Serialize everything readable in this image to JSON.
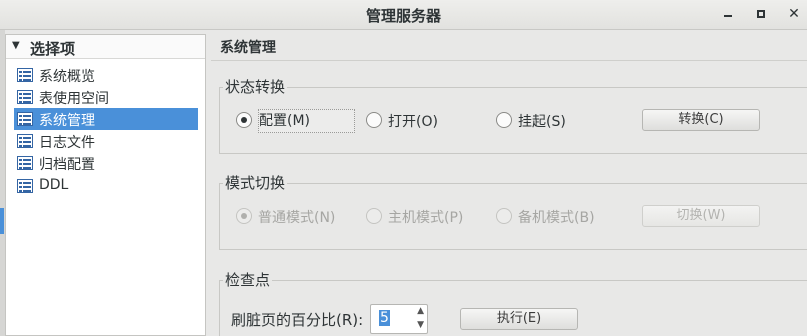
{
  "window": {
    "title": "管理服务器",
    "minimize_icon": "minimize-icon",
    "maximize_icon": "maximize-icon",
    "close_icon": "close-icon",
    "close_glyph": "✕"
  },
  "sidebar": {
    "header": "选择项",
    "items": [
      {
        "label": "系统概览",
        "icon": "list-icon"
      },
      {
        "label": "表使用空间",
        "icon": "list-icon"
      },
      {
        "label": "系统管理",
        "icon": "list-icon",
        "selected": true
      },
      {
        "label": "日志文件",
        "icon": "list-icon"
      },
      {
        "label": "归档配置",
        "icon": "list-icon"
      },
      {
        "label": "DDL",
        "icon": "list-icon"
      }
    ]
  },
  "panel": {
    "title": "系统管理"
  },
  "state_group": {
    "title": "状态转换",
    "options": [
      {
        "label": "配置(M)",
        "checked": true
      },
      {
        "label": "打开(O)",
        "checked": false
      },
      {
        "label": "挂起(S)",
        "checked": false
      }
    ],
    "button": "转换(C)"
  },
  "mode_group": {
    "title": "模式切换",
    "options": [
      {
        "label": "普通模式(N)",
        "checked": true,
        "disabled": true
      },
      {
        "label": "主机模式(P)",
        "checked": false,
        "disabled": true
      },
      {
        "label": "备机模式(B)",
        "checked": false,
        "disabled": true
      }
    ],
    "button": "切换(W)"
  },
  "checkpoint_group": {
    "title": "检查点",
    "spin_label": "刷脏页的百分比(R):",
    "spin_value": "5",
    "button": "执行(E)"
  },
  "colors": {
    "accent": "#4a90d9",
    "background": "#e8e8e7"
  }
}
